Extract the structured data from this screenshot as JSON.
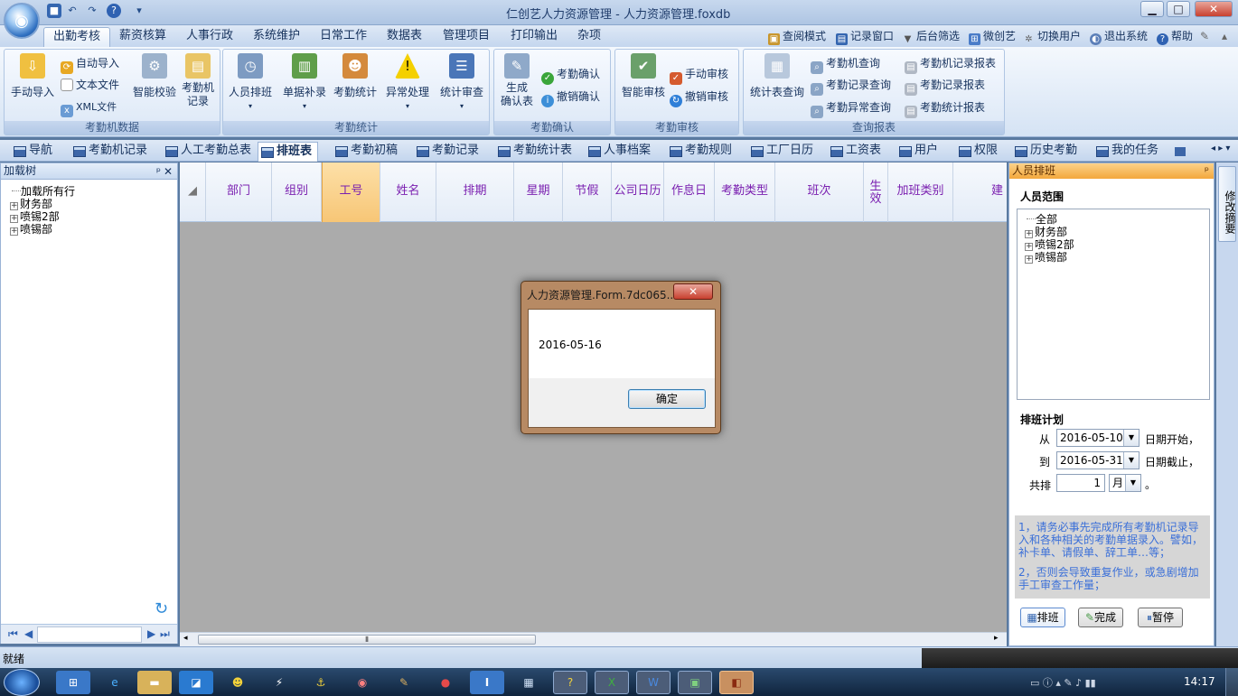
{
  "window": {
    "title": "仁创艺人力资源管理 - 人力资源管理.foxdb",
    "min_glyph": "▁",
    "max_glyph": "□",
    "close_glyph": "✕"
  },
  "menu": {
    "tabs": [
      "出勤考核",
      "薪资核算",
      "人事行政",
      "系统维护",
      "日常工作",
      "数据表",
      "管理项目",
      "打印输出",
      "杂项"
    ],
    "active": "出勤考核"
  },
  "toolbar_right": [
    "查阅模式",
    "记录窗口",
    "后台筛选",
    "微创艺",
    "切换用户",
    "退出系统",
    "帮助"
  ],
  "ribbon": {
    "group1": {
      "label": "考勤机数据",
      "manual_import": "手动导入",
      "auto_import": "自动导入",
      "text_file": "文本文件",
      "xml_file": "XML文件",
      "smart_check": "智能校验",
      "machine_record_line1": "考勤机",
      "machine_record_line2": "记录"
    },
    "group2": {
      "label": "考勤统计",
      "staff_schedule": "人员排班",
      "doc_supplement": "单据补录",
      "attendance_stats": "考勤统计",
      "exception": "异常处理",
      "stats_review": "统计审查"
    },
    "group3": {
      "label": "考勤确认",
      "gen_line1": "生成",
      "gen_line2": "确认表",
      "confirm": "考勤确认",
      "cancel_confirm": "撤销确认"
    },
    "group4": {
      "label": "考勤审核",
      "smart_review": "智能审核",
      "manual_review": "手动审核",
      "cancel_review": "撤销审核"
    },
    "group5": {
      "label": "查询报表",
      "stats_query": "统计表查询",
      "machine_query": "考勤机查询",
      "record_query": "考勤记录查询",
      "exception_query": "考勤异常查询",
      "machine_report": "考勤机记录报表",
      "record_report": "考勤记录报表",
      "stats_report": "考勤统计报表"
    }
  },
  "doc_tabs": [
    "导航",
    "考勤机记录",
    "人工考勤总表",
    "排班表",
    "考勤初稿",
    "考勤记录",
    "考勤统计表",
    "人事档案",
    "考勤规则",
    "工厂日历",
    "工资表",
    "用户",
    "权限",
    "历史考勤",
    "我的任务"
  ],
  "doc_tab_active": "排班表",
  "left_panel": {
    "title": "加载树",
    "tree": [
      "加载所有行",
      "财务部",
      "喷锡2部",
      "喷锡部"
    ]
  },
  "grid": {
    "columns": [
      "部门",
      "组别",
      "工号",
      "姓名",
      "排期",
      "星期",
      "节假",
      "公司日历",
      "作息日",
      "考勤类型",
      "班次",
      "生效",
      "加班类别",
      "建"
    ],
    "highlight": "工号"
  },
  "right_panel": {
    "title": "人员排班",
    "scope_label": "人员范围",
    "tree": [
      "全部",
      "财务部",
      "喷锡2部",
      "喷锡部"
    ],
    "plan_label": "排班计划",
    "from_label": "从",
    "from_date": "2016-05-10",
    "from_suffix": "日期开始，",
    "to_label": "到",
    "to_date": "2016-05-31",
    "to_suffix": "日期截止，",
    "total_label": "共排",
    "total_value": "1",
    "unit": "月",
    "period": "。",
    "note1": "1，请务必事先完成所有考勤机记录导入和各种相关的考勤单据录入。譬如，补卡单、请假单、辞工单…等；",
    "note2": "2，否则会导致重复作业，或急剧增加手工审查工作量；",
    "btn_schedule": "排班",
    "btn_done": "完成",
    "btn_pause": "暂停"
  },
  "sidebar_label": "修改摘要",
  "status": "就绪",
  "dialog": {
    "title": "人力资源管理.Form.7dc065...",
    "message": "2016-05-16",
    "ok": "确定"
  },
  "clock": "14:17",
  "colors": {
    "accent": "#f3a73c",
    "header_text": "#7a1fb0",
    "note_text": "#3a6fd8",
    "gray_body": "#ababab"
  }
}
